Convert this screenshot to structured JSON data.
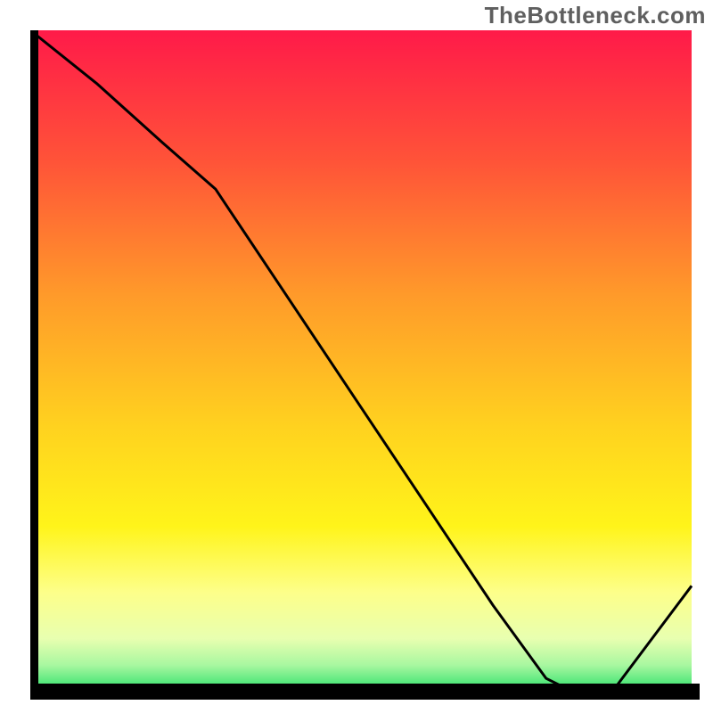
{
  "watermark": "TheBottleneck.com",
  "chart_data": {
    "type": "line",
    "title": "",
    "xlabel": "",
    "ylabel": "",
    "xlim": [
      0,
      100
    ],
    "ylim": [
      0,
      100
    ],
    "grid": false,
    "series": [
      {
        "name": "curve",
        "x": [
          0,
          10,
          20,
          28,
          40,
          50,
          60,
          70,
          78,
          82,
          88,
          100
        ],
        "y": [
          100,
          92,
          83,
          76,
          58,
          43,
          28,
          13,
          2,
          0,
          0,
          16
        ]
      }
    ],
    "marker": {
      "x_start": 78,
      "x_end": 88,
      "y": 0.5,
      "color": "#d1635f"
    },
    "gradient_stops": [
      {
        "offset": 0,
        "color": "#ff1a49"
      },
      {
        "offset": 20,
        "color": "#ff5438"
      },
      {
        "offset": 40,
        "color": "#ff9a2a"
      },
      {
        "offset": 60,
        "color": "#ffd21f"
      },
      {
        "offset": 75,
        "color": "#fff41a"
      },
      {
        "offset": 85,
        "color": "#fdff8a"
      },
      {
        "offset": 92,
        "color": "#e8ffb0"
      },
      {
        "offset": 96,
        "color": "#a8f7a0"
      },
      {
        "offset": 100,
        "color": "#2be06a"
      }
    ],
    "axis_color": "#000000",
    "line_color": "#000000",
    "line_width": 3
  }
}
